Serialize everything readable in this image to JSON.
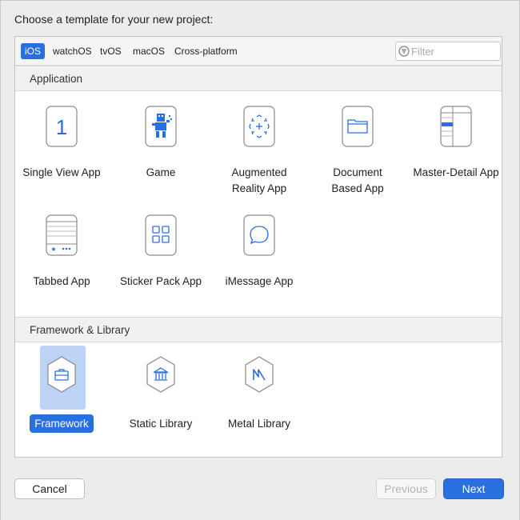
{
  "dialog": {
    "prompt": "Choose a template for your new project:"
  },
  "tabs": [
    {
      "label": "iOS",
      "active": true
    },
    {
      "label": "watchOS",
      "active": false
    },
    {
      "label": "tvOS",
      "active": false
    },
    {
      "label": "macOS",
      "active": false
    },
    {
      "label": "Cross-platform",
      "active": false
    }
  ],
  "filter": {
    "placeholder": "Filter",
    "value": "",
    "icon": "filter-icon"
  },
  "sections": {
    "application": {
      "title": "Application",
      "templates": [
        {
          "label": "Single View App",
          "icon": "single-view-app-icon"
        },
        {
          "label": "Game",
          "icon": "game-icon"
        },
        {
          "label": "Augmented\nReality App",
          "icon": "augmented-reality-icon"
        },
        {
          "label": "Document\nBased App",
          "icon": "document-icon"
        },
        {
          "label": "Master-Detail App",
          "icon": "master-detail-icon"
        },
        {
          "label": "Tabbed App",
          "icon": "tabbed-app-icon"
        },
        {
          "label": "Sticker Pack App",
          "icon": "sticker-pack-icon"
        },
        {
          "label": "iMessage App",
          "icon": "imessage-icon"
        }
      ]
    },
    "framework": {
      "title": "Framework & Library",
      "templates": [
        {
          "label": "Framework",
          "icon": "framework-icon",
          "selected": true
        },
        {
          "label": "Static Library",
          "icon": "static-library-icon"
        },
        {
          "label": "Metal Library",
          "icon": "metal-library-icon"
        }
      ]
    }
  },
  "buttons": {
    "cancel": "Cancel",
    "previous": "Previous",
    "next": "Next"
  },
  "colors": {
    "accent": "#2a6fde",
    "selection": "#bcd3f5"
  }
}
